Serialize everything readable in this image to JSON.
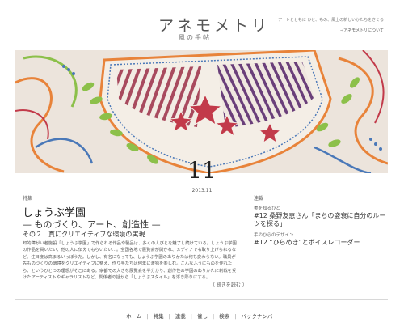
{
  "site": {
    "title": "アネモメトリ",
    "subtitle": "風の手帖",
    "tagline": "アートとともに ひと、もの、風土の新しいかたちをさぐる",
    "about_link": "→アネモメトリについて"
  },
  "hero": {
    "image_alt": "刺繍とビーズで装飾された布のアップ",
    "month": "11",
    "date": "2013.11"
  },
  "feature": {
    "category": "特集",
    "title": "しょうぶ学園",
    "subtitle": "— ものづくり、アート、創造性 —",
    "part": "その２　真にクリエイティブな環境の実現",
    "body": "知的障がい者施設「しょうぶ学園」で作られる作品や製品は、多くの人びとを魅了し続けている。しょうぶ学園の作品を買いたい、他の人に伝えてもらいたい…。全国各地で展覧会が開かれ、メディアでも取り上げられるなど、注目度は高まるいっぽうだ。しかし、有名になっても、しょうぶ学園のありかたは何も変わらない。職員が先ものづくりの環境をクリエイティブに整え、作り手たちは何年に渡独を楽しむ。こんなふうにものを作れたら、というひとつの理想がそこにある。家都での大きな展覧会を半分かり、創作性の学園のありかたに刺戟を受けたアーティストやギャラリストなど、関係者の話から「しょうぶスタイル」を浮き彫りにする。",
    "read_more": "（ 続きを読む ）"
  },
  "series": {
    "heading": "連載",
    "items": [
      {
        "name": "美を知るひと",
        "title": "#12 桑野友恵さん「まちの盛衰に自分のルーツを探る」"
      },
      {
        "name": "手のひらのデザイン",
        "title": "#12 “ひらめき”とボイスレコーダー"
      }
    ]
  },
  "footer": {
    "nav": [
      "ホーム",
      "特集",
      "連載",
      "催し",
      "検索",
      "バックナンバー"
    ],
    "separator": "|"
  },
  "colors": {
    "fabric": "#ece4dc",
    "thread_orange": "#e8833a",
    "thread_green": "#8cc04a",
    "thread_red": "#c23a4a",
    "thread_purple": "#7a4a88",
    "bead_blue": "#4a78b8"
  }
}
